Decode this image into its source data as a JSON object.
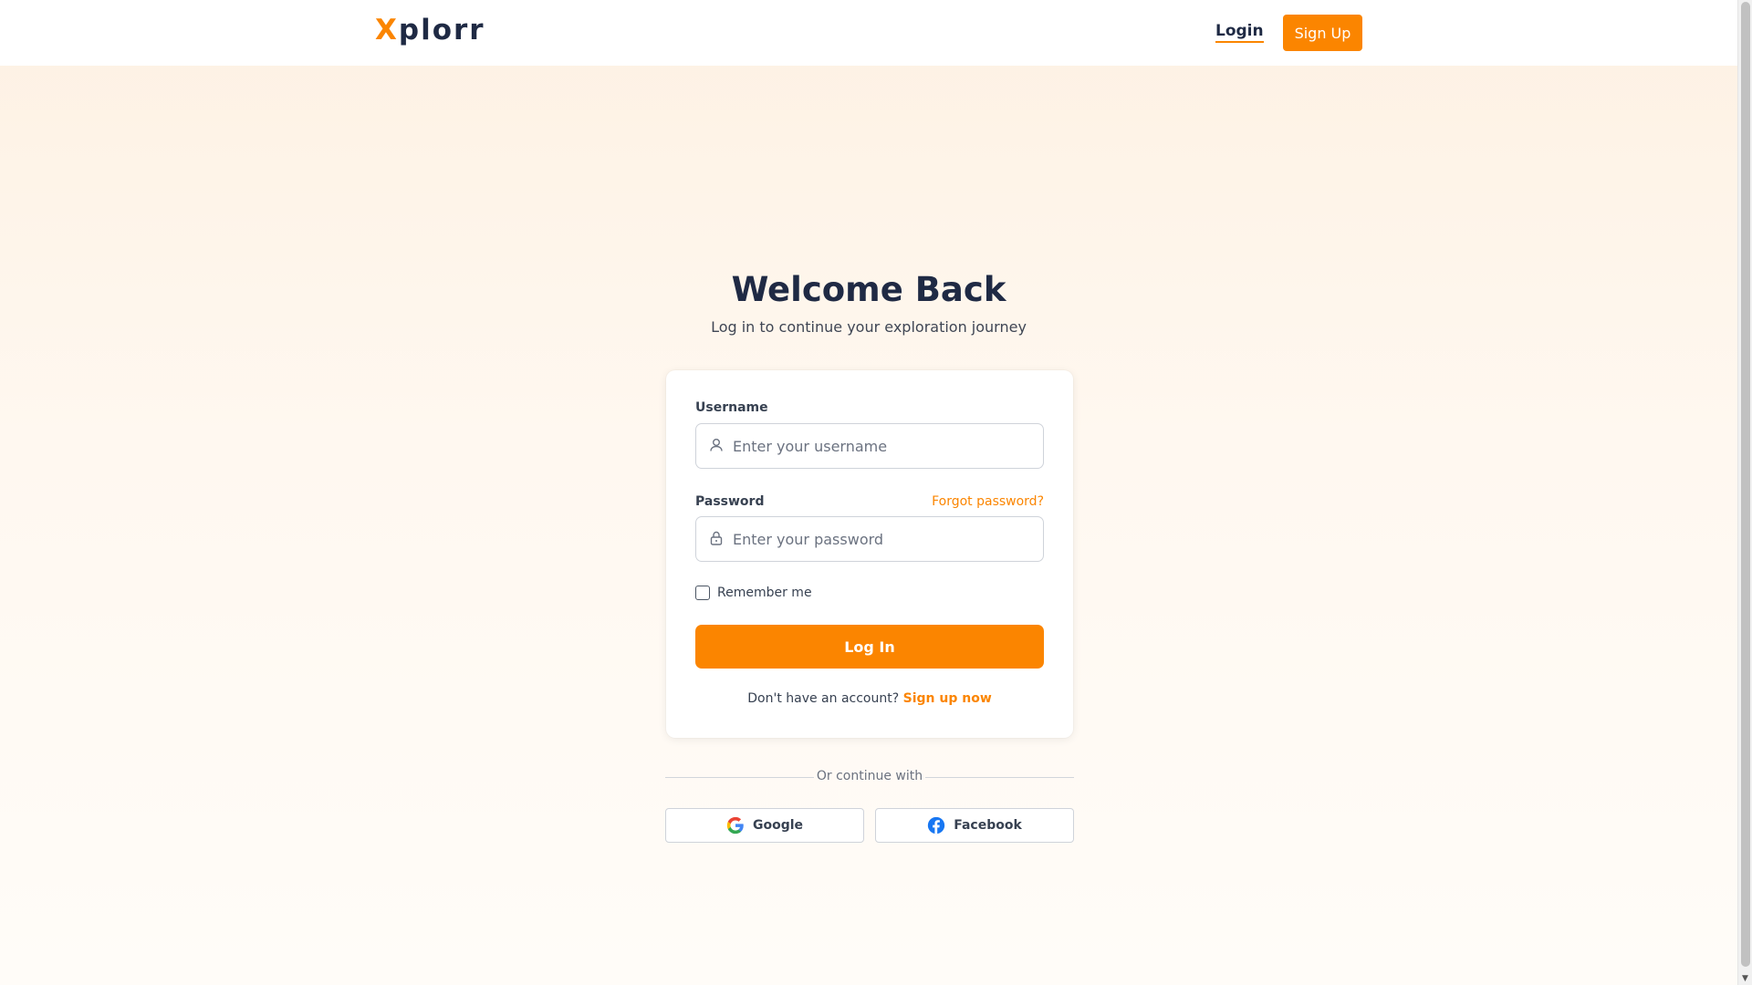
{
  "header": {
    "logo_first": "X",
    "logo_rest": "plorr",
    "login_label": "Login",
    "signup_label": "Sign Up"
  },
  "hero": {
    "title": "Welcome Back",
    "subtitle": "Log in to continue your exploration journey"
  },
  "form": {
    "username_label": "Username",
    "username_placeholder": "Enter your username",
    "username_value": "",
    "password_label": "Password",
    "forgot_label": "Forgot password?",
    "password_placeholder": "Enter your password",
    "password_value": "",
    "remember_label": "Remember me",
    "remember_checked": false,
    "submit_label": "Log In",
    "no_account_text": "Don't have an account?",
    "signup_link": "Sign up now"
  },
  "social": {
    "divider_text": "Or continue with",
    "google_label": "Google",
    "google_icon": "google-icon",
    "facebook_label": "Facebook",
    "facebook_icon": "facebook-icon"
  },
  "colors": {
    "accent": "#fb8500",
    "text_dark": "#1f2a44",
    "facebook_blue": "#1877f2"
  },
  "icons": {
    "username_field": "user-icon",
    "password_field": "lock-icon"
  }
}
